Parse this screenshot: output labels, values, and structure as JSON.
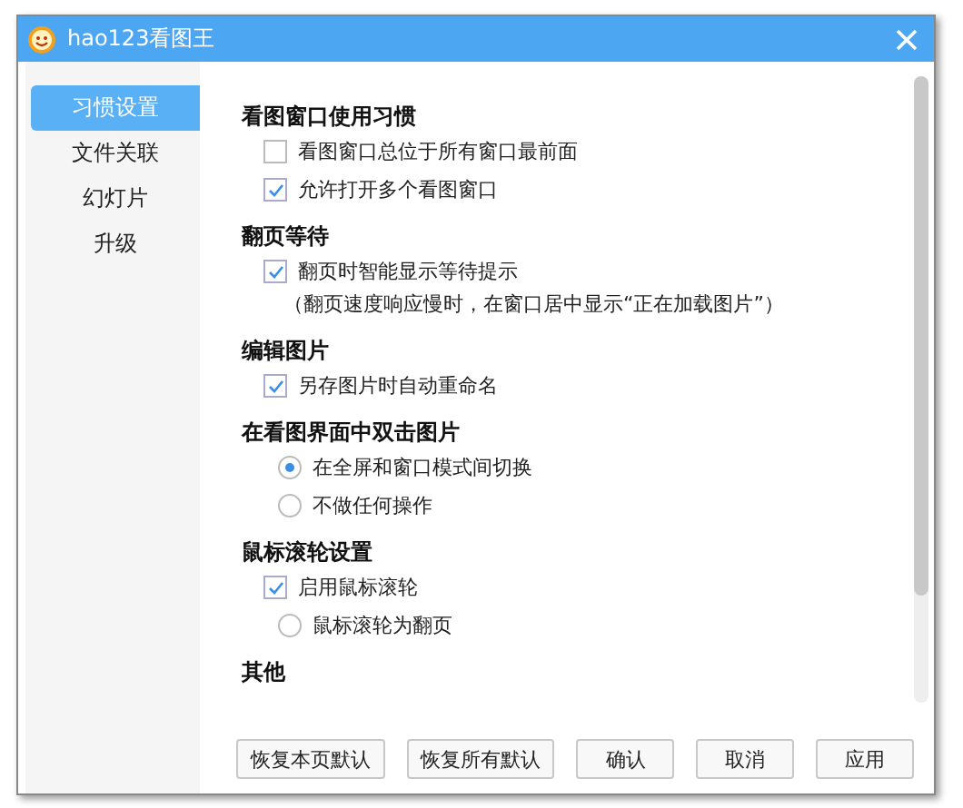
{
  "window": {
    "title": "hao123看图王"
  },
  "sidebar": {
    "items": [
      {
        "label": "习惯设置",
        "selected": true
      },
      {
        "label": "文件关联",
        "selected": false
      },
      {
        "label": "幻灯片",
        "selected": false
      },
      {
        "label": "升级",
        "selected": false
      }
    ]
  },
  "sections": [
    {
      "title": "看图窗口使用习惯",
      "items": [
        {
          "kind": "checkbox",
          "label": "看图窗口总位于所有窗口最前面",
          "checked": false
        },
        {
          "kind": "checkbox",
          "label": "允许打开多个看图窗口",
          "checked": true
        }
      ]
    },
    {
      "title": "翻页等待",
      "items": [
        {
          "kind": "checkbox",
          "label": "翻页时智能显示等待提示",
          "checked": true
        },
        {
          "kind": "note",
          "label": "（翻页速度响应慢时，在窗口居中显示“正在加载图片”）"
        }
      ]
    },
    {
      "title": "编辑图片",
      "items": [
        {
          "kind": "checkbox",
          "label": "另存图片时自动重命名",
          "checked": true
        }
      ]
    },
    {
      "title": "在看图界面中双击图片",
      "items": [
        {
          "kind": "radio",
          "label": "在全屏和窗口模式间切换",
          "selected": true
        },
        {
          "kind": "radio",
          "label": "不做任何操作",
          "selected": false
        }
      ]
    },
    {
      "title": "鼠标滚轮设置",
      "items": [
        {
          "kind": "checkbox",
          "label": "启用鼠标滚轮",
          "checked": true
        },
        {
          "kind": "subradio",
          "label": "鼠标滚轮为翻页",
          "selected": false
        }
      ]
    },
    {
      "title": "其他"
    }
  ],
  "buttons": [
    "恢复本页默认",
    "恢复所有默认",
    "确认",
    "取消",
    "应用"
  ]
}
